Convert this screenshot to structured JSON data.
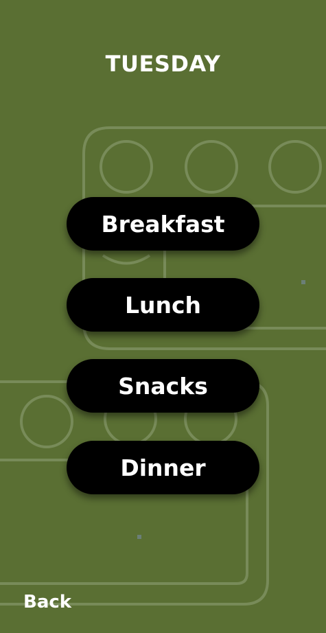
{
  "header": {
    "title": "TUESDAY"
  },
  "meals": {
    "breakfast": "Breakfast",
    "lunch": "Lunch",
    "snacks": "Snacks",
    "dinner": "Dinner"
  },
  "footer": {
    "back_label": "Back"
  },
  "theme": {
    "background": "#5a6f33",
    "button_background": "#000000",
    "text_color": "#ffffff",
    "outline_color": "#7e9160"
  }
}
